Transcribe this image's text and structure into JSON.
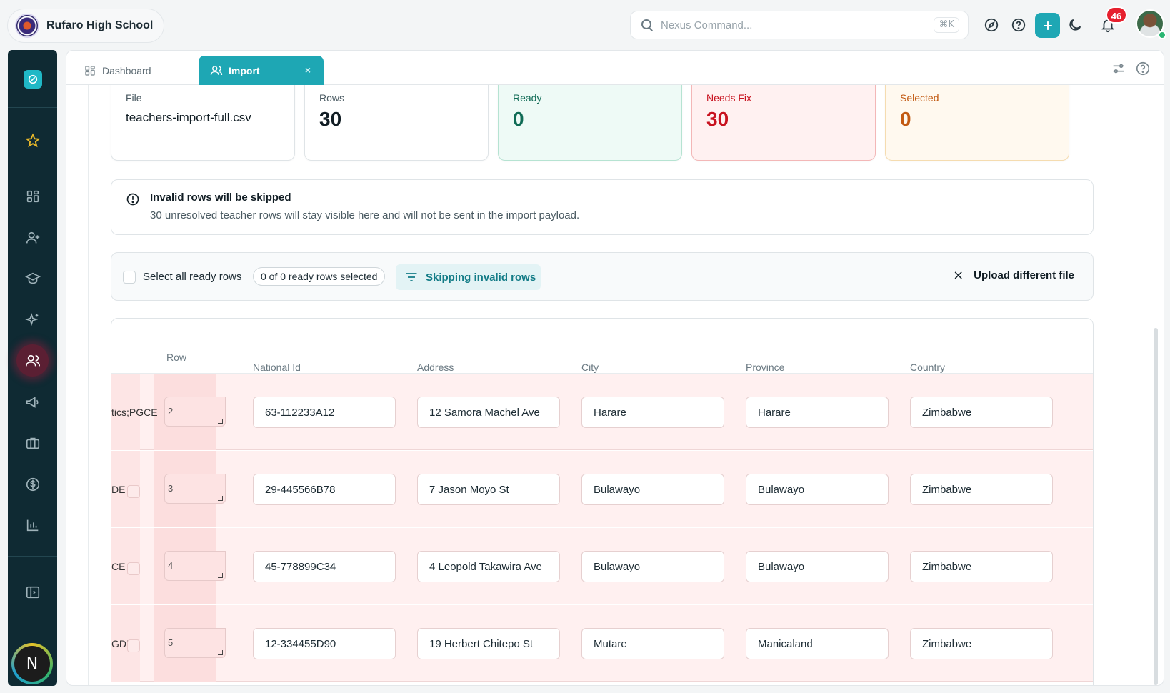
{
  "header": {
    "school_name": "Rufaro High School",
    "search_placeholder": "Nexus Command...",
    "search_shortcut": "⌘K",
    "notification_count": "46"
  },
  "tabs": [
    {
      "label": "Dashboard",
      "icon": "dashboard-icon"
    },
    {
      "label": "Import",
      "icon": "users-icon",
      "close": "×"
    }
  ],
  "stats": {
    "file": {
      "label": "File",
      "value": "teachers-import-full.csv"
    },
    "rows": {
      "label": "Rows",
      "value": "30"
    },
    "ready": {
      "label": "Ready",
      "value": "0"
    },
    "needs_fix": {
      "label": "Needs Fix",
      "value": "30"
    },
    "selected": {
      "label": "Selected",
      "value": "0"
    }
  },
  "alert": {
    "title": "Invalid rows will be skipped",
    "text": "30 unresolved teacher rows will stay visible here and will not be sent in the import payload."
  },
  "toolbar": {
    "select_all_label": "Select all ready rows",
    "selected_count": "0 of 0 ready rows selected",
    "skip_label": "Skipping invalid rows",
    "upload_label": "Upload different file",
    "upload_icon": "×"
  },
  "table": {
    "columns": {
      "row": "Row",
      "national_id": "National Id",
      "address": "Address",
      "city": "City",
      "province": "Province",
      "country": "Country"
    },
    "rows": [
      {
        "fragment": "tics;PGCE",
        "row": "2",
        "national_id": "63-112233A12",
        "address": "12 Samora Machel Ave",
        "city": "Harare",
        "province": "Harare",
        "country": "Zimbabwe"
      },
      {
        "fragment": "DE",
        "row": "3",
        "national_id": "29-445566B78",
        "address": "7 Jason Moyo St",
        "city": "Bulawayo",
        "province": "Bulawayo",
        "country": "Zimbabwe"
      },
      {
        "fragment": "CE",
        "row": "4",
        "national_id": "45-778899C34",
        "address": "4 Leopold Takawira Ave",
        "city": "Bulawayo",
        "province": "Bulawayo",
        "country": "Zimbabwe"
      },
      {
        "fragment": "GDE",
        "row": "5",
        "national_id": "12-334455D90",
        "address": "19 Herbert Chitepo St",
        "city": "Mutare",
        "province": "Manicaland",
        "country": "Zimbabwe"
      }
    ]
  },
  "sidebar": {
    "items": [
      "favorites-icon",
      "dashboard-icon",
      "add-user-icon",
      "graduation-cap-icon",
      "sparkles-icon",
      "users-icon",
      "megaphone-icon",
      "briefcase-icon",
      "dollar-icon",
      "bar-chart-icon"
    ],
    "active": "users-icon",
    "user_initial": "N"
  },
  "colors": {
    "accent": "#1ea7b4",
    "sidebar": "#0f2a33",
    "error": "#c8121f",
    "success": "#0f6b55",
    "warning": "#c25a12"
  }
}
